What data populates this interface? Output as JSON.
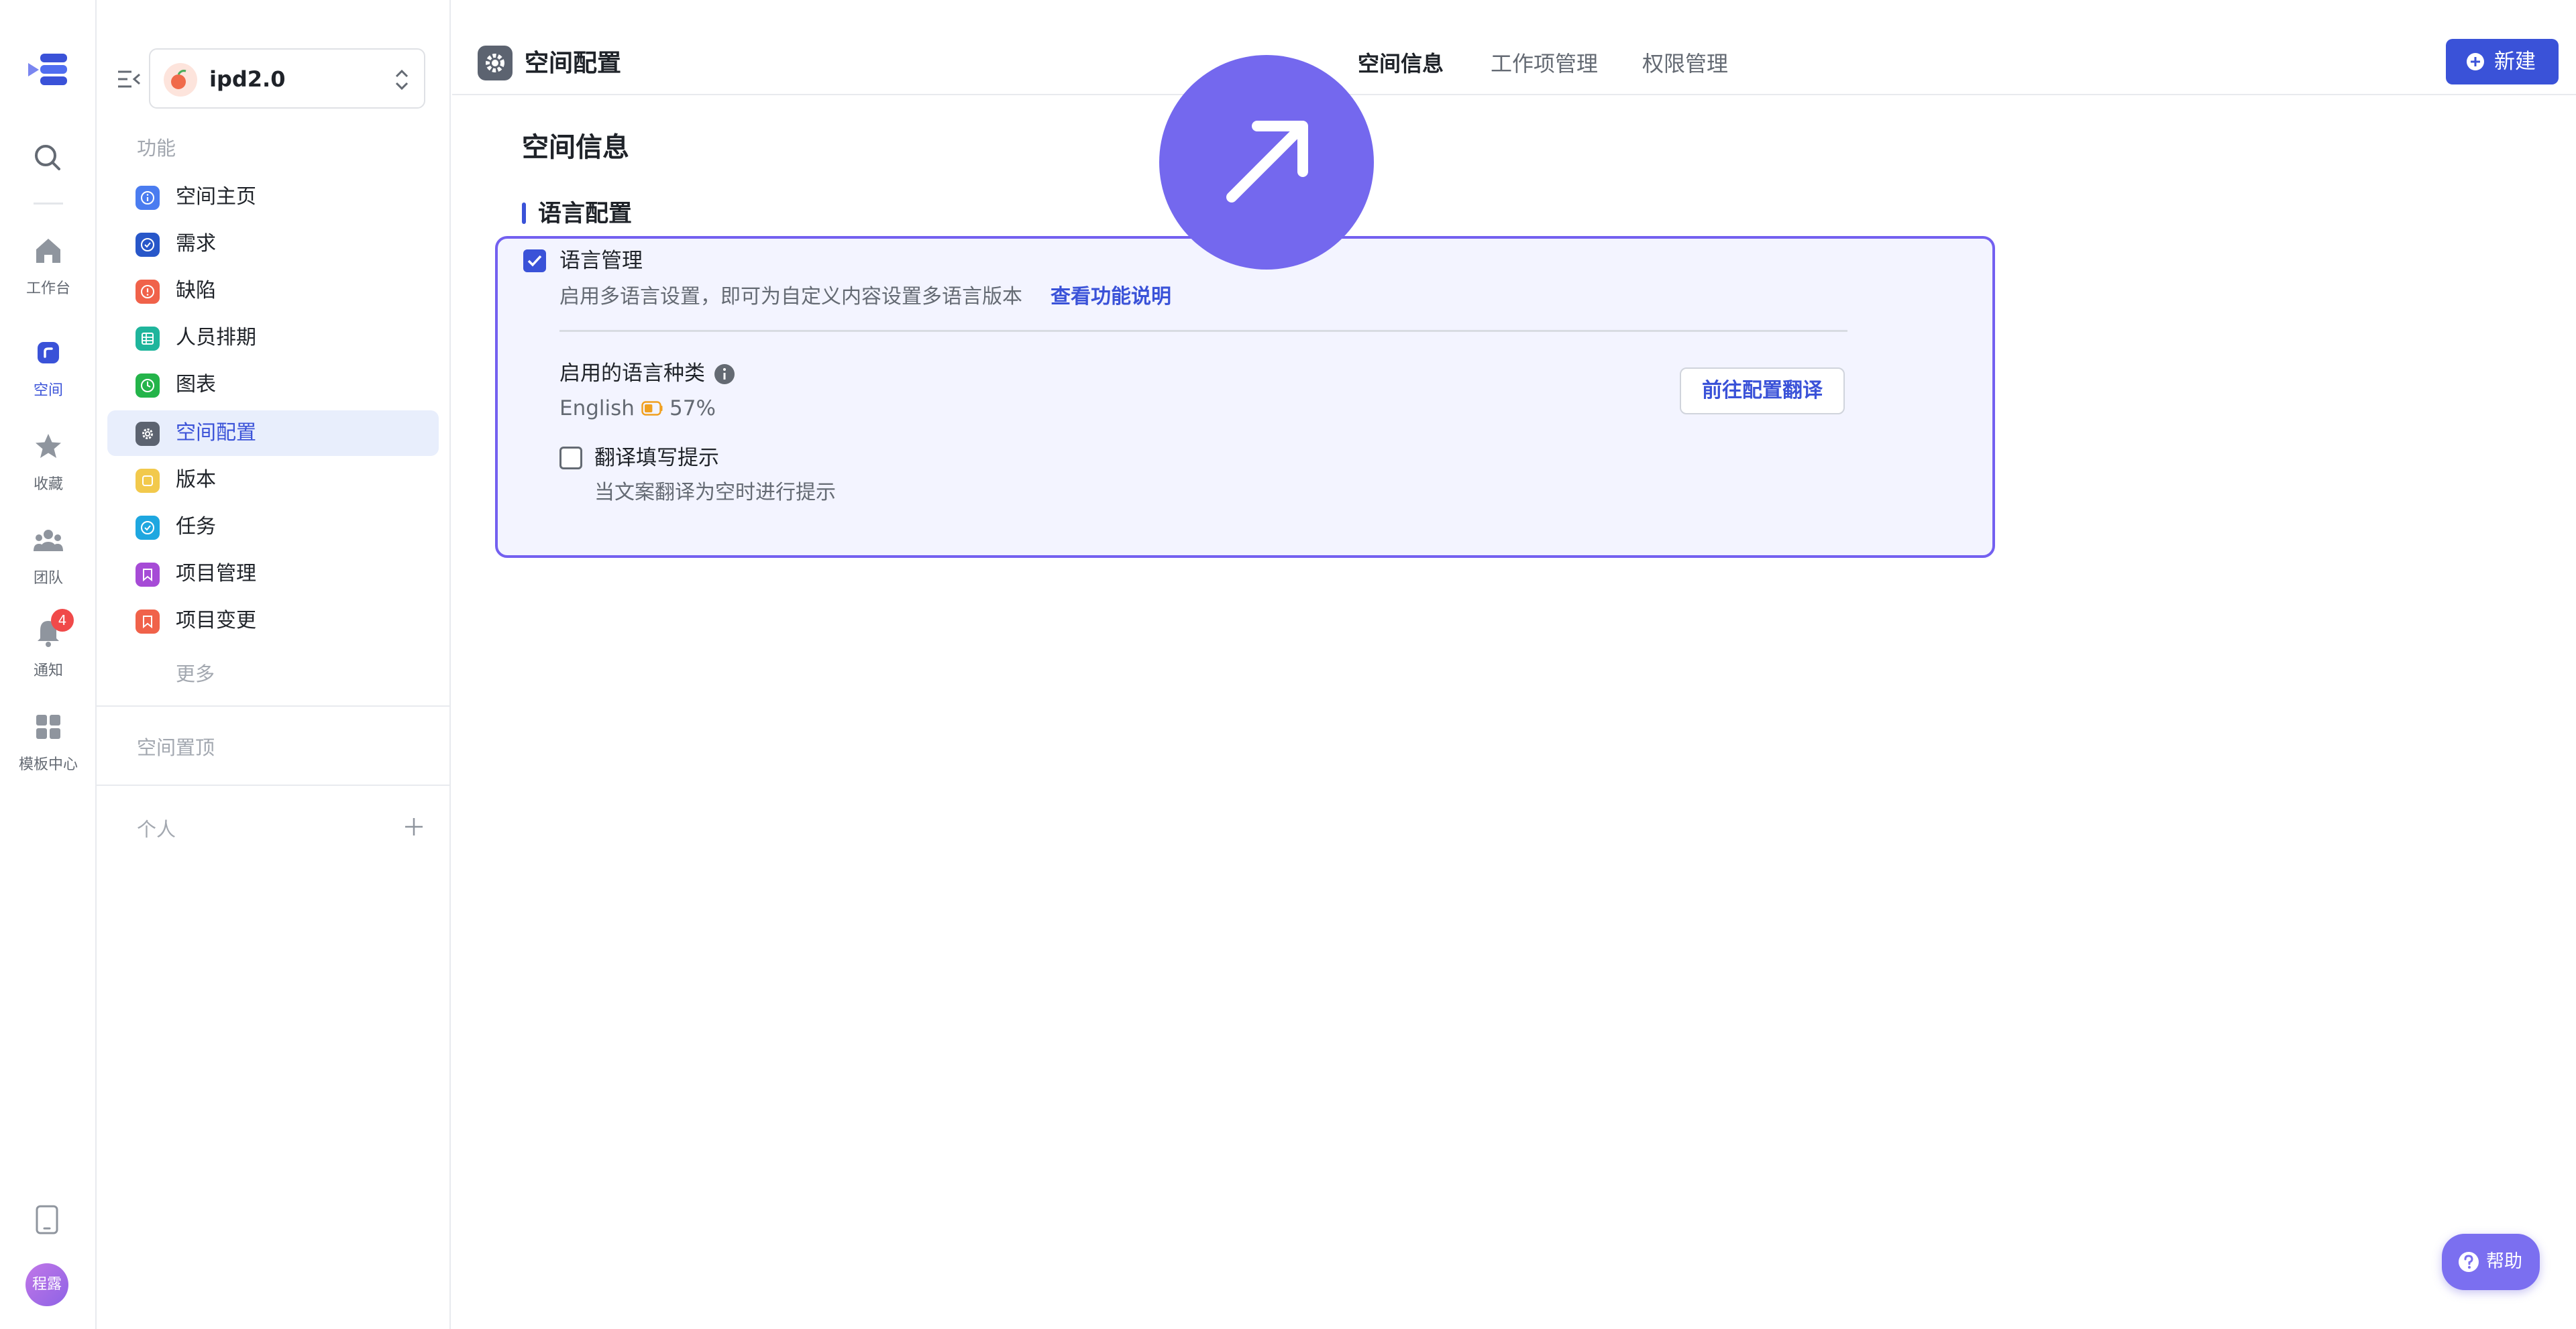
{
  "rail": {
    "items": [
      {
        "label": "工作台",
        "icon": "home-icon"
      },
      {
        "label": "空间",
        "icon": "space-icon",
        "active": true
      },
      {
        "label": "收藏",
        "icon": "star-icon"
      },
      {
        "label": "团队",
        "icon": "team-icon"
      },
      {
        "label": "通知",
        "icon": "bell-icon",
        "badge": "4"
      },
      {
        "label": "模板中心",
        "icon": "template-icon"
      }
    ],
    "avatar": "程露"
  },
  "sidebar": {
    "project_name": "ipd2.0",
    "section_label": "功能",
    "items": [
      {
        "label": "空间主页",
        "icon": "info-icon",
        "color": "#4a7cf0"
      },
      {
        "label": "需求",
        "icon": "check-circle-icon",
        "color": "#2857c9"
      },
      {
        "label": "缺陷",
        "icon": "alert-icon",
        "color": "#f0624a"
      },
      {
        "label": "人员排期",
        "icon": "table-icon",
        "color": "#1fb59c"
      },
      {
        "label": "图表",
        "icon": "clock-icon",
        "color": "#24b44a"
      },
      {
        "label": "空间配置",
        "icon": "gear-icon",
        "color": "#5c6370",
        "active": true
      },
      {
        "label": "版本",
        "icon": "square-icon",
        "color": "#f2c94c"
      },
      {
        "label": "任务",
        "icon": "check-circle-icon",
        "color": "#1ea7e0"
      },
      {
        "label": "项目管理",
        "icon": "bookmark-icon",
        "color": "#a64bd6"
      },
      {
        "label": "项目变更",
        "icon": "bookmark-icon",
        "color": "#f0624a"
      }
    ],
    "more_label": "更多",
    "pinned_label": "空间置顶",
    "personal_label": "个人"
  },
  "header": {
    "title": "空间配置",
    "tabs": [
      {
        "label": "空间信息",
        "active": true
      },
      {
        "label": "工作项管理"
      },
      {
        "label": "权限管理"
      }
    ],
    "new_button": "新建"
  },
  "main": {
    "page_title": "空间信息",
    "section_title": "语言配置",
    "language_mgmt": {
      "label": "语言管理",
      "checked": true,
      "description": "启用多语言设置，即可为自定义内容设置多语言版本",
      "link": "查看功能说明"
    },
    "enabled_languages": {
      "label": "启用的语言种类",
      "language": "English",
      "progress": "57%",
      "progress_value": 0.57,
      "config_button": "前往配置翻译"
    },
    "translation_hint": {
      "label": "翻译填写提示",
      "checked": false,
      "description": "当文案翻译为空时进行提示"
    }
  },
  "help_button": "帮助",
  "colors": {
    "accent": "#3a52d8",
    "card_border": "#7360f0",
    "card_bg": "#f3f4ff",
    "bubble": "#7468ee"
  }
}
